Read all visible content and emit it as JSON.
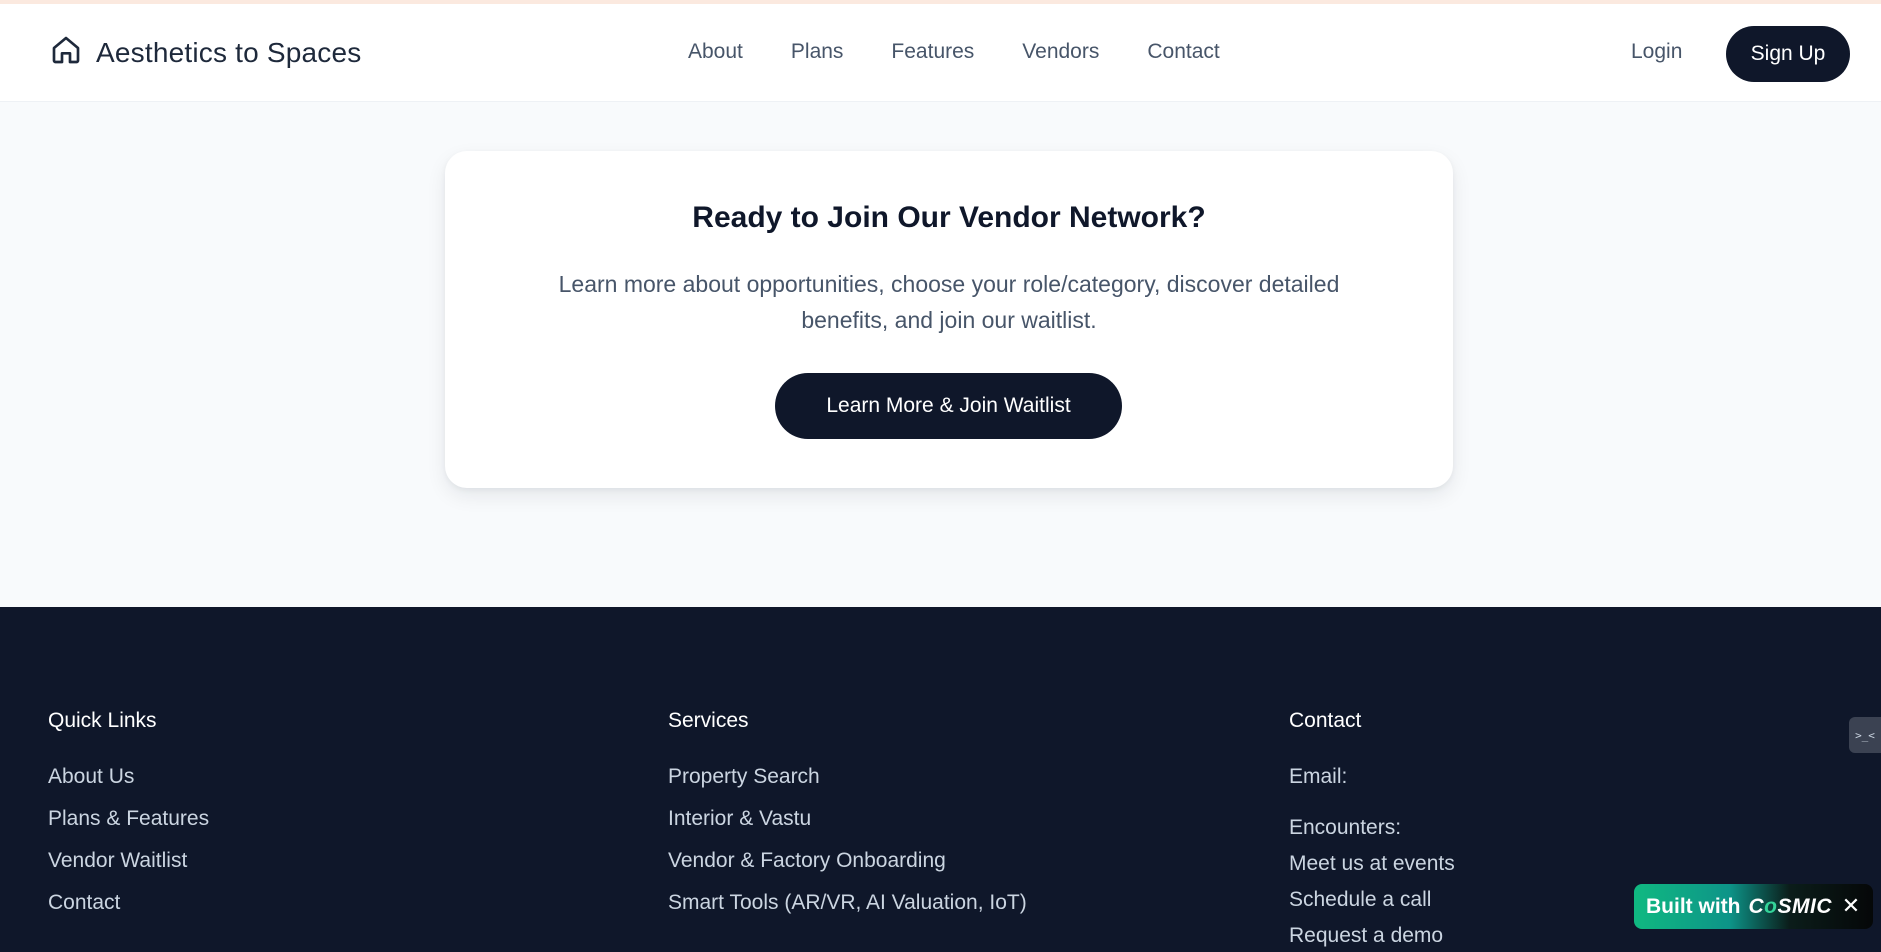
{
  "colors": {
    "primary_dark": "#0f172a",
    "muted_text": "#475569",
    "page_bg": "#f8fafc",
    "accent_green": "#10b981"
  },
  "header": {
    "brand_name": "Aesthetics to Spaces",
    "brand_icon": "home-icon",
    "nav": [
      "About",
      "Plans",
      "Features",
      "Vendors",
      "Contact"
    ],
    "login_label": "Login",
    "signup_label": "Sign Up"
  },
  "cta": {
    "title": "Ready to Join Our Vendor Network?",
    "description": "Learn more about opportunities, choose your role/category, discover detailed benefits, and join our waitlist.",
    "button_label": "Learn More & Join Waitlist"
  },
  "footer": {
    "quick_links": {
      "heading": "Quick Links",
      "items": [
        "About Us",
        "Plans & Features",
        "Vendor Waitlist",
        "Contact"
      ]
    },
    "services": {
      "heading": "Services",
      "items": [
        "Property Search",
        "Interior & Vastu",
        "Vendor & Factory Onboarding",
        "Smart Tools (AR/VR, AI Valuation, IoT)"
      ]
    },
    "contact": {
      "heading": "Contact",
      "email_label": "Email:",
      "encounters_label": "Encounters:",
      "items": [
        "Meet us at events",
        "Schedule a call",
        "Request a demo"
      ]
    }
  },
  "widgets": {
    "terminal_glyph": ">_<",
    "badge_text": "Built with",
    "badge_brand_prefix": "C",
    "badge_brand_o": "o",
    "badge_brand_suffix": "SMIC",
    "badge_close": "✕"
  }
}
